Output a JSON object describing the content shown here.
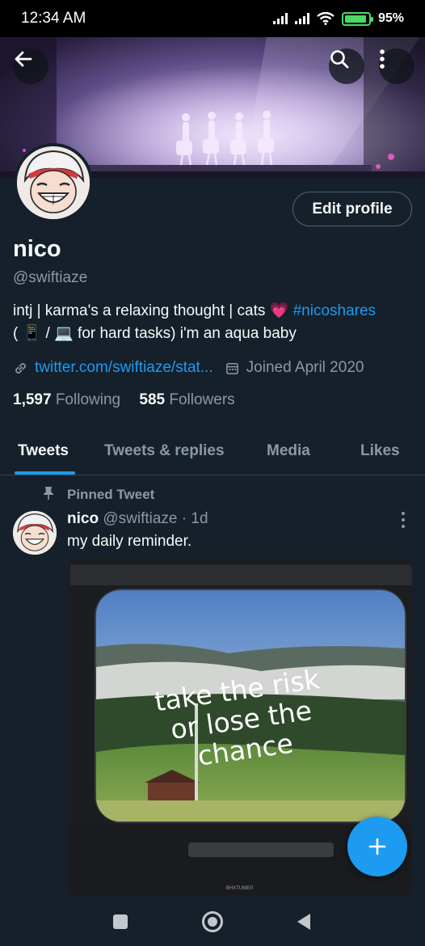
{
  "status_bar": {
    "time": "12:34 AM",
    "battery": "95%"
  },
  "header": {
    "back_icon": "arrow-left-icon",
    "search_icon": "search-icon",
    "more_icon": "more-vertical-icon",
    "edit_profile_label": "Edit profile"
  },
  "profile": {
    "name": "nico",
    "handle": "@swiftiaze",
    "bio_text": "intj | karma's a relaxing thought | cats",
    "bio_heart": "💗",
    "bio_hashtag": "#nicoshares",
    "bio_line2": "( 📱 / 💻 for hard tasks) i'm an aqua baby",
    "link": "twitter.com/swiftiaze/stat...",
    "joined": "Joined April 2020",
    "following_count": "1,597",
    "following_label": "Following",
    "followers_count": "585",
    "followers_label": "Followers"
  },
  "tabs": [
    {
      "label": "Tweets",
      "active": true
    },
    {
      "label": "Tweets & replies",
      "active": false
    },
    {
      "label": "Media",
      "active": false
    },
    {
      "label": "Likes",
      "active": false
    }
  ],
  "pinned_tweet": {
    "pinned_label": "Pinned Tweet",
    "author_name": "nico",
    "author_handle": "@swiftiaze",
    "separator": "·",
    "time": "1d",
    "text": "my daily reminder.",
    "image_caption_lines": [
      "take the risk",
      "or lose the",
      "chance"
    ],
    "image_watermark": "BHXTUMEP."
  },
  "fab": {
    "icon": "plus-icon"
  },
  "nav_bar": {
    "icons": [
      "recents-square-icon",
      "home-circle-icon",
      "back-triangle-icon"
    ]
  },
  "colors": {
    "accent": "#1d9bf0",
    "background": "#15202b",
    "muted": "#8b98a5",
    "text": "#f7f9f9"
  }
}
